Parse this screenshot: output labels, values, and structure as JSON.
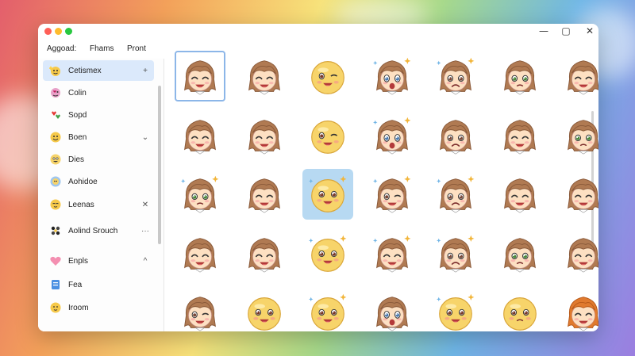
{
  "colors": {
    "accent": "#dbe9fb",
    "selection_outline": "#8cb6e8",
    "close": "#ff5f57",
    "minimize": "#febc2e",
    "zoom": "#28c840"
  },
  "window": {
    "controls": {
      "minimize": "—",
      "maximize": "▢",
      "close": "✕"
    }
  },
  "menu": {
    "items": [
      "Aggoad:",
      "Fhams",
      "Pront"
    ]
  },
  "sidebar": {
    "items": [
      {
        "label": "Cetismex",
        "icon": "sparkle-face-icon",
        "action": "+",
        "active": true
      },
      {
        "label": "Colin",
        "icon": "heart-face-icon",
        "action": ""
      },
      {
        "label": "Sopd",
        "icon": "heart-pair-icon",
        "action": ""
      },
      {
        "label": "Boen",
        "icon": "smile-face-icon",
        "action": "⌄"
      },
      {
        "label": "Dies",
        "icon": "grin-face-icon",
        "action": ""
      },
      {
        "label": "Aohidoe",
        "icon": "globe-face-icon",
        "action": ""
      },
      {
        "label": "Leenas",
        "icon": "blush-face-icon",
        "action": "✕"
      },
      {
        "label": "Aolind Srouch",
        "icon": "cluster-icon",
        "action": "···"
      },
      {
        "label": "Enpls",
        "icon": "heart-icon",
        "action": "^"
      },
      {
        "label": "Fea",
        "icon": "document-icon",
        "action": ""
      },
      {
        "label": "Iroom",
        "icon": "face-icon",
        "action": ""
      }
    ]
  },
  "grid": {
    "cells": [
      {
        "type": "girl",
        "mood": "happy",
        "selected": true
      },
      {
        "type": "girl",
        "mood": "happy"
      },
      {
        "type": "ball",
        "mood": "wink"
      },
      {
        "type": "girl",
        "mood": "surprised",
        "sparkle": true
      },
      {
        "type": "girl",
        "mood": "sad",
        "sparkle": true
      },
      {
        "type": "girl",
        "mood": "worried"
      },
      {
        "type": "girl",
        "mood": "happy"
      },
      {
        "type": "girl",
        "mood": "happy"
      },
      {
        "type": "girl",
        "mood": "happy"
      },
      {
        "type": "ball",
        "mood": "wink"
      },
      {
        "type": "girl",
        "mood": "surprised",
        "sparkle": true
      },
      {
        "type": "girl",
        "mood": "sad"
      },
      {
        "type": "girl",
        "mood": "happy"
      },
      {
        "type": "girl",
        "mood": "worried"
      },
      {
        "type": "girl",
        "mood": "worried",
        "sparkle": true
      },
      {
        "type": "girl",
        "mood": "happy"
      },
      {
        "type": "ball",
        "mood": "happy",
        "blue": true,
        "sparkle": true
      },
      {
        "type": "girl",
        "mood": "wink",
        "sparkle": true
      },
      {
        "type": "girl",
        "mood": "sad",
        "sparkle": true
      },
      {
        "type": "girl",
        "mood": "happy"
      },
      {
        "type": "girl",
        "mood": "happy"
      },
      {
        "type": "girl",
        "mood": "happy"
      },
      {
        "type": "girl",
        "mood": "happy"
      },
      {
        "type": "ball",
        "mood": "happy",
        "sparkle": true
      },
      {
        "type": "girl",
        "mood": "happy",
        "sparkle": true
      },
      {
        "type": "girl",
        "mood": "sad",
        "sparkle": true
      },
      {
        "type": "girl",
        "mood": "worried"
      },
      {
        "type": "girl",
        "mood": "happy"
      },
      {
        "type": "girl",
        "mood": "wink"
      },
      {
        "type": "ball",
        "mood": "happy"
      },
      {
        "type": "ball",
        "mood": "happy",
        "sparkle": true
      },
      {
        "type": "girl",
        "mood": "surprised"
      },
      {
        "type": "ball",
        "mood": "happy",
        "sparkle": true
      },
      {
        "type": "ball",
        "mood": "worried"
      },
      {
        "type": "girl",
        "mood": "happy",
        "orange": true
      }
    ]
  }
}
